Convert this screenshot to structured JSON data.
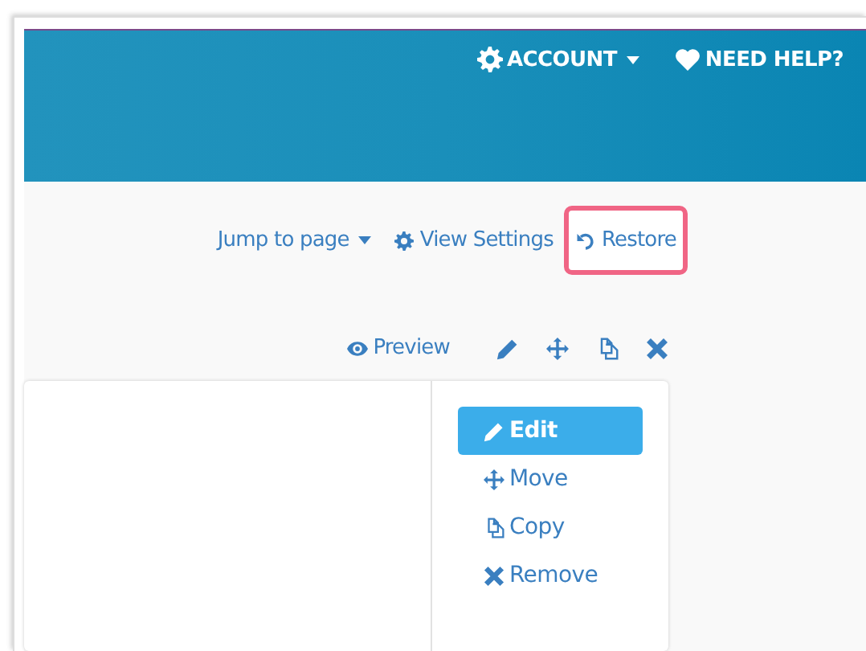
{
  "header": {
    "nav": [
      {
        "label": "ACCOUNT",
        "dropdown": true
      },
      {
        "label": "NEED HELP?",
        "dropdown": false
      }
    ]
  },
  "toolbar": {
    "links": [
      {
        "label": "Jump to page",
        "dropdown": true,
        "highlighted": false
      },
      {
        "label": "View Settings",
        "dropdown": false,
        "highlighted": false
      },
      {
        "label": "Restore",
        "dropdown": false,
        "highlighted": true
      }
    ]
  },
  "item_actions": {
    "preview": "Preview"
  },
  "action_menu": [
    {
      "label": "Edit",
      "selected": true
    },
    {
      "label": "Move",
      "selected": false
    },
    {
      "label": "Copy",
      "selected": false
    },
    {
      "label": "Remove",
      "selected": false
    }
  ]
}
